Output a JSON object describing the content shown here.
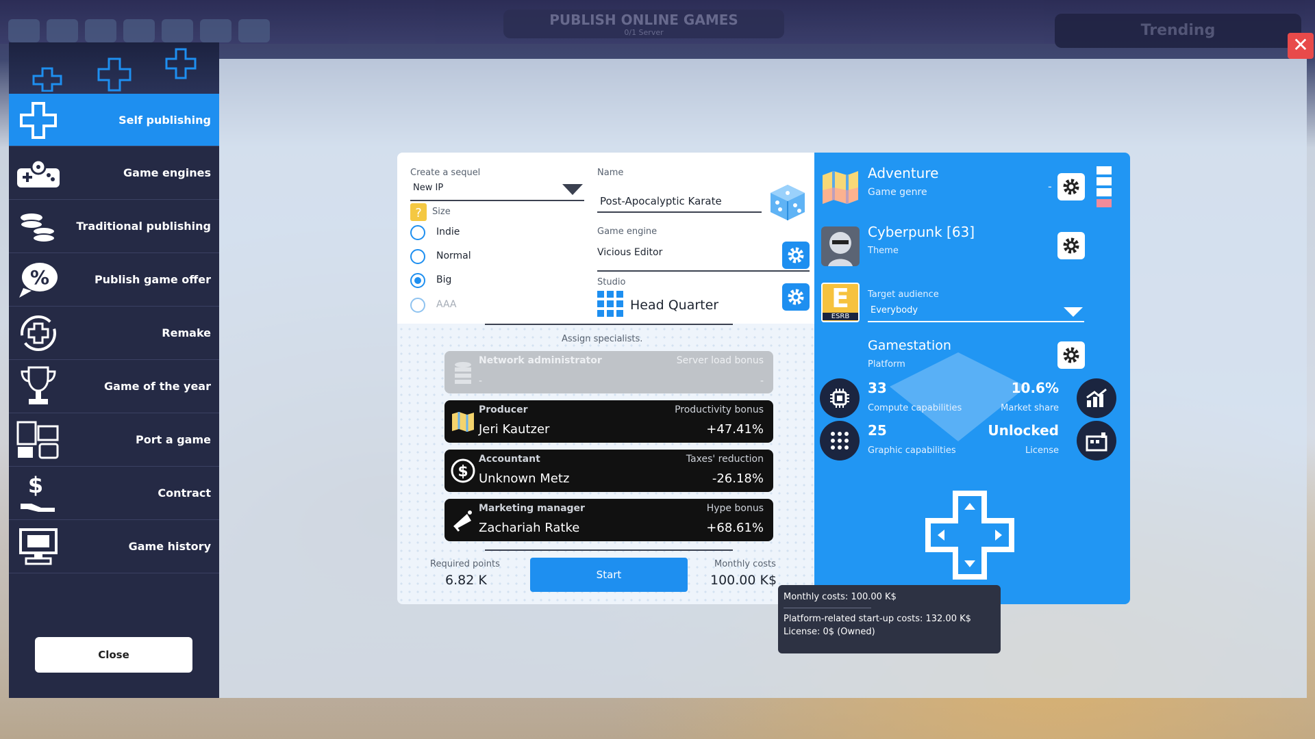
{
  "background": {
    "title": "PUBLISH ONLINE GAMES",
    "subtitle": "0/1 Server",
    "trending": "Trending"
  },
  "sidebar": {
    "items": [
      {
        "label": "Self publishing",
        "icon": "dpad-plus-icon",
        "active": true
      },
      {
        "label": "Game engines",
        "icon": "gamepad-gear-icon"
      },
      {
        "label": "Traditional publishing",
        "icon": "coins-stack-icon"
      },
      {
        "label": "Publish game offer",
        "icon": "percent-bubble-icon"
      },
      {
        "label": "Remake",
        "icon": "recycle-plus-icon"
      },
      {
        "label": "Game of the year",
        "icon": "trophy-icon"
      },
      {
        "label": "Port a game",
        "icon": "devices-icon"
      },
      {
        "label": "Contract",
        "icon": "dollar-hand-icon"
      },
      {
        "label": "Game history",
        "icon": "monitor-history-icon"
      }
    ],
    "close_label": "Close"
  },
  "form": {
    "sequel_label": "Create a sequel",
    "sequel_value": "New IP",
    "size_label": "Size",
    "sizes": [
      {
        "label": "Indie",
        "checked": false,
        "disabled": false
      },
      {
        "label": "Normal",
        "checked": false,
        "disabled": false
      },
      {
        "label": "Big",
        "checked": true,
        "disabled": false
      },
      {
        "label": "AAA",
        "checked": false,
        "disabled": true
      }
    ],
    "name_label": "Name",
    "name_value": "Post-Apocalyptic Karate",
    "engine_label": "Game engine",
    "engine_value": "Vicious Editor",
    "studio_label": "Studio",
    "studio_value": "Head Quarter",
    "assign_label": "Assign specialists.",
    "specialists": [
      {
        "role": "Network administrator",
        "bonus_label": "Server load bonus",
        "name": "-",
        "bonus": "-",
        "disabled": true
      },
      {
        "role": "Producer",
        "bonus_label": "Productivity bonus",
        "name": "Jeri Kautzer",
        "bonus": "+47.41%"
      },
      {
        "role": "Accountant",
        "bonus_label": "Taxes' reduction",
        "name": "Unknown Metz",
        "bonus": "-26.18%"
      },
      {
        "role": "Marketing manager",
        "bonus_label": "Hype bonus",
        "name": "Zachariah Ratke",
        "bonus": "+68.61%"
      }
    ],
    "required_points_label": "Required points",
    "required_points": "6.82 K",
    "start_label": "Start",
    "monthly_costs_label": "Monthly costs",
    "monthly_costs": "100.00 K$"
  },
  "details": {
    "genre": "Adventure",
    "genre_label": "Game genre",
    "genre_dash": "-",
    "theme": "Cyberpunk [63]",
    "theme_label": "Theme",
    "audience_label": "Target audience",
    "audience_value": "Everybody",
    "rating_letter": "E",
    "rating_text": "ESRB",
    "platform": "Gamestation",
    "platform_label": "Platform",
    "compute_value": "33",
    "compute_label": "Compute capabilities",
    "market_share": "10.6%",
    "market_share_label": "Market share",
    "graphic_value": "25",
    "graphic_label": "Graphic capabilities",
    "license_value": "Unlocked",
    "license_label": "License"
  },
  "tooltip": {
    "line1": "Monthly costs: 100.00 K$",
    "line2": "Platform-related start-up costs: 132.00 K$",
    "line3": "License: 0$ (Owned)"
  },
  "colors": {
    "accent": "#1e8ff0",
    "sidebar": "#252a45",
    "close": "#e84a4a"
  }
}
